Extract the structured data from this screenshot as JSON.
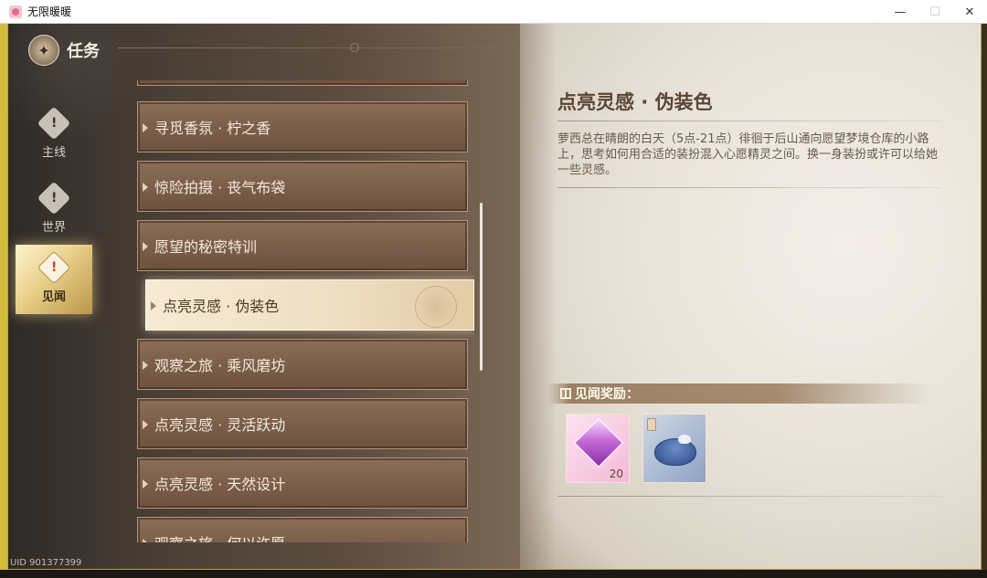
{
  "window": {
    "title": "无限暖暖",
    "controls": {
      "minimize": "—",
      "maximize": "☐",
      "close": "✕"
    }
  },
  "header": {
    "title": "任务",
    "emblem_icon": "compass-icon"
  },
  "categories": [
    {
      "label": "主线",
      "icon": "main-quest-icon",
      "active": false
    },
    {
      "label": "世界",
      "icon": "world-quest-icon",
      "active": false
    },
    {
      "label": "见闻",
      "icon": "insight-quest-icon",
      "active": true
    }
  ],
  "quests": [
    {
      "label": "寻觅香氛 · 柠之香"
    },
    {
      "label": "惊险拍摄 · 丧气布袋"
    },
    {
      "label": "愿望的秘密特训"
    },
    {
      "label": "点亮灵感 · 伪装色",
      "selected": true
    },
    {
      "label": "观察之旅 · 乘风磨坊"
    },
    {
      "label": "点亮灵感 · 灵活跃动"
    },
    {
      "label": "点亮灵感 · 天然设计"
    },
    {
      "label": "观察之旅 · 何以许愿"
    }
  ],
  "detail": {
    "title": "点亮灵感 · 伪装色",
    "description": "萝西总在晴朗的白天（5点-21点）徘徊于后山通向愿望梦境仓库的小路上，思考如何用合适的装扮混入心愿精灵之间。换一身装扮或许可以给她一些灵感。"
  },
  "rewards": {
    "header": "见闻奖励：",
    "items": [
      {
        "type": "gem",
        "count": "20"
      },
      {
        "type": "hat"
      }
    ]
  },
  "footer": {
    "uid": "UID 901377399"
  },
  "colors": {
    "accent_gold": "#e9cf89",
    "parchment": "#ece7de",
    "list_item": "#7a5d49"
  }
}
